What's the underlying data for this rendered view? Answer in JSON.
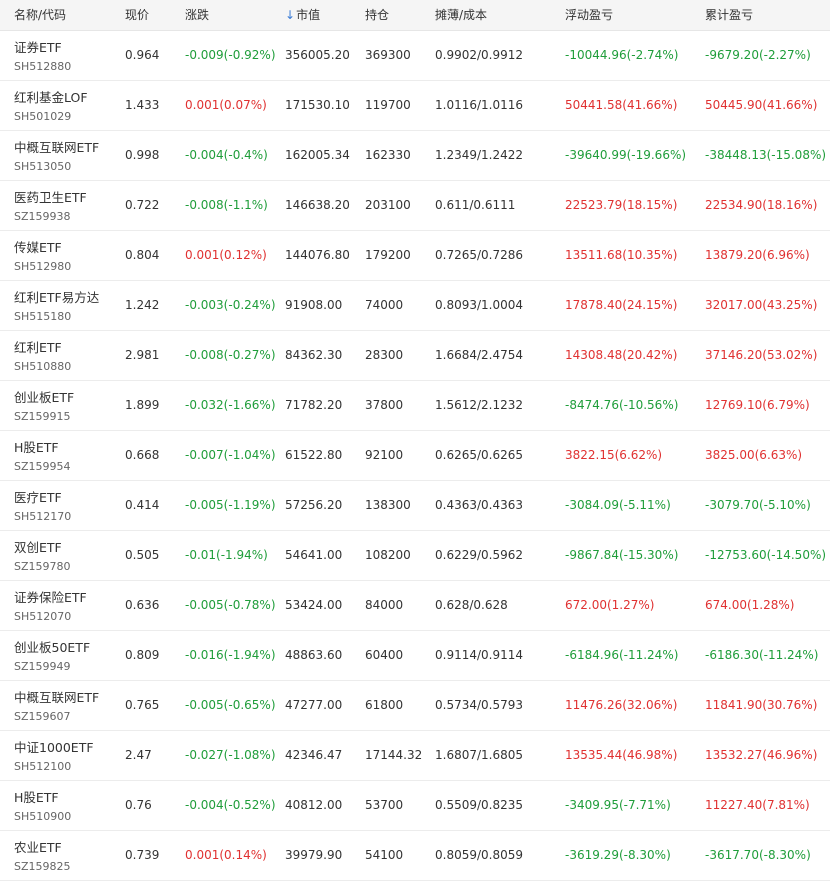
{
  "columns": {
    "name": "名称/代码",
    "price": "现价",
    "change": "涨跌",
    "market_value": "市值",
    "position": "持仓",
    "cost": "摊薄/成本",
    "floating_pnl": "浮动盈亏",
    "total_pnl": "累计盈亏",
    "sort_icon": "arrow-down-icon"
  },
  "colors": {
    "up": "#e03131",
    "down": "#1f9d3a",
    "sort": "#3a7bd5"
  },
  "rows": [
    {
      "name": "证券ETF",
      "code": "SH512880",
      "price": "0.964",
      "change": "-0.009(-0.92%)",
      "change_dir": "down",
      "mv": "356005.20",
      "pos": "369300",
      "cost": "0.9902/0.9912",
      "float": "-10044.96(-2.74%)",
      "float_dir": "down",
      "total": "-9679.20(-2.27%)",
      "total_dir": "down"
    },
    {
      "name": "红利基金LOF",
      "code": "SH501029",
      "price": "1.433",
      "change": "0.001(0.07%)",
      "change_dir": "up",
      "mv": "171530.10",
      "pos": "119700",
      "cost": "1.0116/1.0116",
      "float": "50441.58(41.66%)",
      "float_dir": "up",
      "total": "50445.90(41.66%)",
      "total_dir": "up"
    },
    {
      "name": "中概互联网ETF",
      "code": "SH513050",
      "price": "0.998",
      "change": "-0.004(-0.4%)",
      "change_dir": "down",
      "mv": "162005.34",
      "pos": "162330",
      "cost": "1.2349/1.2422",
      "float": "-39640.99(-19.66%)",
      "float_dir": "down",
      "total": "-38448.13(-15.08%)",
      "total_dir": "down"
    },
    {
      "name": "医药卫生ETF",
      "code": "SZ159938",
      "price": "0.722",
      "change": "-0.008(-1.1%)",
      "change_dir": "down",
      "mv": "146638.20",
      "pos": "203100",
      "cost": "0.611/0.6111",
      "float": "22523.79(18.15%)",
      "float_dir": "up",
      "total": "22534.90(18.16%)",
      "total_dir": "up"
    },
    {
      "name": "传媒ETF",
      "code": "SH512980",
      "price": "0.804",
      "change": "0.001(0.12%)",
      "change_dir": "up",
      "mv": "144076.80",
      "pos": "179200",
      "cost": "0.7265/0.7286",
      "float": "13511.68(10.35%)",
      "float_dir": "up",
      "total": "13879.20(6.96%)",
      "total_dir": "up"
    },
    {
      "name": "红利ETF易方达",
      "code": "SH515180",
      "price": "1.242",
      "change": "-0.003(-0.24%)",
      "change_dir": "down",
      "mv": "91908.00",
      "pos": "74000",
      "cost": "0.8093/1.0004",
      "float": "17878.40(24.15%)",
      "float_dir": "up",
      "total": "32017.00(43.25%)",
      "total_dir": "up"
    },
    {
      "name": "红利ETF",
      "code": "SH510880",
      "price": "2.981",
      "change": "-0.008(-0.27%)",
      "change_dir": "down",
      "mv": "84362.30",
      "pos": "28300",
      "cost": "1.6684/2.4754",
      "float": "14308.48(20.42%)",
      "float_dir": "up",
      "total": "37146.20(53.02%)",
      "total_dir": "up"
    },
    {
      "name": "创业板ETF",
      "code": "SZ159915",
      "price": "1.899",
      "change": "-0.032(-1.66%)",
      "change_dir": "down",
      "mv": "71782.20",
      "pos": "37800",
      "cost": "1.5612/2.1232",
      "float": "-8474.76(-10.56%)",
      "float_dir": "down",
      "total": "12769.10(6.79%)",
      "total_dir": "up"
    },
    {
      "name": "H股ETF",
      "code": "SZ159954",
      "price": "0.668",
      "change": "-0.007(-1.04%)",
      "change_dir": "down",
      "mv": "61522.80",
      "pos": "92100",
      "cost": "0.6265/0.6265",
      "float": "3822.15(6.62%)",
      "float_dir": "up",
      "total": "3825.00(6.63%)",
      "total_dir": "up"
    },
    {
      "name": "医疗ETF",
      "code": "SH512170",
      "price": "0.414",
      "change": "-0.005(-1.19%)",
      "change_dir": "down",
      "mv": "57256.20",
      "pos": "138300",
      "cost": "0.4363/0.4363",
      "float": "-3084.09(-5.11%)",
      "float_dir": "down",
      "total": "-3079.70(-5.10%)",
      "total_dir": "down"
    },
    {
      "name": "双创ETF",
      "code": "SZ159780",
      "price": "0.505",
      "change": "-0.01(-1.94%)",
      "change_dir": "down",
      "mv": "54641.00",
      "pos": "108200",
      "cost": "0.6229/0.5962",
      "float": "-9867.84(-15.30%)",
      "float_dir": "down",
      "total": "-12753.60(-14.50%)",
      "total_dir": "down"
    },
    {
      "name": "证券保险ETF",
      "code": "SH512070",
      "price": "0.636",
      "change": "-0.005(-0.78%)",
      "change_dir": "down",
      "mv": "53424.00",
      "pos": "84000",
      "cost": "0.628/0.628",
      "float": "672.00(1.27%)",
      "float_dir": "up",
      "total": "674.00(1.28%)",
      "total_dir": "up"
    },
    {
      "name": "创业板50ETF",
      "code": "SZ159949",
      "price": "0.809",
      "change": "-0.016(-1.94%)",
      "change_dir": "down",
      "mv": "48863.60",
      "pos": "60400",
      "cost": "0.9114/0.9114",
      "float": "-6184.96(-11.24%)",
      "float_dir": "down",
      "total": "-6186.30(-11.24%)",
      "total_dir": "down"
    },
    {
      "name": "中概互联网ETF",
      "code": "SZ159607",
      "price": "0.765",
      "change": "-0.005(-0.65%)",
      "change_dir": "down",
      "mv": "47277.00",
      "pos": "61800",
      "cost": "0.5734/0.5793",
      "float": "11476.26(32.06%)",
      "float_dir": "up",
      "total": "11841.90(30.76%)",
      "total_dir": "up"
    },
    {
      "name": "中证1000ETF",
      "code": "SH512100",
      "price": "2.47",
      "change": "-0.027(-1.08%)",
      "change_dir": "down",
      "mv": "42346.47",
      "pos": "17144.32",
      "cost": "1.6807/1.6805",
      "float": "13535.44(46.98%)",
      "float_dir": "up",
      "total": "13532.27(46.96%)",
      "total_dir": "up"
    },
    {
      "name": "H股ETF",
      "code": "SH510900",
      "price": "0.76",
      "change": "-0.004(-0.52%)",
      "change_dir": "down",
      "mv": "40812.00",
      "pos": "53700",
      "cost": "0.5509/0.8235",
      "float": "-3409.95(-7.71%)",
      "float_dir": "down",
      "total": "11227.40(7.81%)",
      "total_dir": "up"
    },
    {
      "name": "农业ETF",
      "code": "SZ159825",
      "price": "0.739",
      "change": "0.001(0.14%)",
      "change_dir": "up",
      "mv": "39979.90",
      "pos": "54100",
      "cost": "0.8059/0.8059",
      "float": "-3619.29(-8.30%)",
      "float_dir": "down",
      "total": "-3617.70(-8.30%)",
      "total_dir": "down"
    }
  ]
}
